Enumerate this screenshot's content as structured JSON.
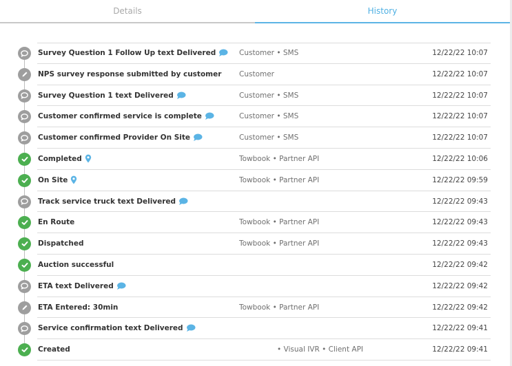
{
  "tabs": [
    {
      "label": "Details",
      "active": false
    },
    {
      "label": "History",
      "active": true
    }
  ],
  "colors": {
    "accent": "#5bb4e5",
    "success": "#4caf50",
    "neutral": "#9e9e9e"
  },
  "history": [
    {
      "title": "Survey Question 1 Follow Up text Delivered",
      "status_icon": "chat-bubble-icon",
      "status": "gray",
      "extra_icon": "chat-icon",
      "source": "Customer • SMS",
      "time": "12/22/22 10:07"
    },
    {
      "title": "NPS survey response submitted by customer",
      "status_icon": "pencil-icon",
      "status": "gray",
      "extra_icon": "",
      "source": "Customer",
      "time": "12/22/22 10:07"
    },
    {
      "title": "Survey Question 1 text Delivered",
      "status_icon": "chat-bubble-icon",
      "status": "gray",
      "extra_icon": "chat-icon",
      "source": "Customer • SMS",
      "time": "12/22/22 10:07"
    },
    {
      "title": "Customer confirmed service is complete",
      "status_icon": "chat-bubble-icon",
      "status": "gray",
      "extra_icon": "chat-icon",
      "source": "Customer • SMS",
      "time": "12/22/22 10:07"
    },
    {
      "title": "Customer confirmed Provider On Site",
      "status_icon": "chat-bubble-icon",
      "status": "gray",
      "extra_icon": "chat-icon",
      "source": "Customer • SMS",
      "time": "12/22/22 10:07"
    },
    {
      "title": "Completed",
      "status_icon": "check-icon",
      "status": "green",
      "extra_icon": "location-pin-icon",
      "source": "Towbook • Partner API",
      "time": "12/22/22 10:06"
    },
    {
      "title": "On Site",
      "status_icon": "check-icon",
      "status": "green",
      "extra_icon": "location-pin-icon",
      "source": "Towbook • Partner API",
      "time": "12/22/22 09:59"
    },
    {
      "title": "Track service truck text Delivered",
      "status_icon": "chat-bubble-icon",
      "status": "gray",
      "extra_icon": "chat-icon",
      "source": "",
      "time": "12/22/22 09:43"
    },
    {
      "title": "En Route",
      "status_icon": "check-icon",
      "status": "green",
      "extra_icon": "",
      "source": "Towbook • Partner API",
      "time": "12/22/22 09:43"
    },
    {
      "title": "Dispatched",
      "status_icon": "check-icon",
      "status": "green",
      "extra_icon": "",
      "source": "Towbook • Partner API",
      "time": "12/22/22 09:43"
    },
    {
      "title": "Auction successful",
      "status_icon": "check-icon",
      "status": "green",
      "extra_icon": "",
      "source": "",
      "time": "12/22/22 09:42"
    },
    {
      "title": "ETA text Delivered",
      "status_icon": "chat-bubble-icon",
      "status": "gray",
      "extra_icon": "chat-icon",
      "source": "",
      "time": "12/22/22 09:42"
    },
    {
      "title": "ETA Entered: 30min",
      "status_icon": "pencil-icon",
      "status": "gray",
      "extra_icon": "",
      "source": "Towbook • Partner API",
      "time": "12/22/22 09:42"
    },
    {
      "title": "Service confirmation text Delivered",
      "status_icon": "chat-bubble-icon",
      "status": "gray",
      "extra_icon": "chat-icon",
      "source": "",
      "time": "12/22/22 09:41"
    },
    {
      "title": "Created",
      "status_icon": "check-icon",
      "status": "green",
      "extra_icon": "",
      "source": "• Visual IVR • Client API",
      "source_indent": true,
      "time": "12/22/22 09:41"
    }
  ]
}
